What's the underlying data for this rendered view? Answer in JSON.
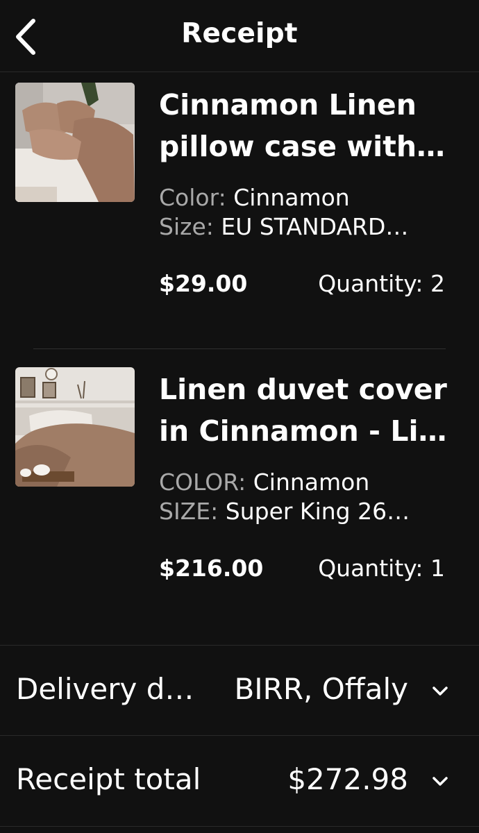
{
  "header": {
    "title": "Receipt",
    "back_icon": "chevron-left-icon"
  },
  "items": [
    {
      "name": "Cinnamon Linen pillow case with…",
      "name_line1": "Cinnamon Linen",
      "name_line2": "pillow case with…",
      "attr1_key": "Color:",
      "attr1_value": "Cinnamon",
      "attr2_key": "Size:",
      "attr2_value": "EU STANDARD…",
      "price": "$29.00",
      "quantity": "Quantity: 2"
    },
    {
      "name": "Linen duvet cover in Cinnamon - Li…",
      "name_line1": "Linen duvet cover",
      "name_line2": "in Cinnamon - Li…",
      "attr1_key": "COLOR:",
      "attr1_value": "Cinnamon",
      "attr2_key": "SIZE:",
      "attr2_value": "Super King 26…",
      "price": "$216.00",
      "quantity": "Quantity: 1"
    }
  ],
  "summary": {
    "delivery_label": "Delivery d…",
    "delivery_value": "BIRR, Offaly",
    "total_label": "Receipt total",
    "total_value": "$272.98",
    "expand_icon": "chevron-down-icon"
  },
  "colors": {
    "background": "#111111",
    "text": "#ffffff",
    "muted": "#a9a9a9",
    "divider": "#2a2a2a"
  }
}
